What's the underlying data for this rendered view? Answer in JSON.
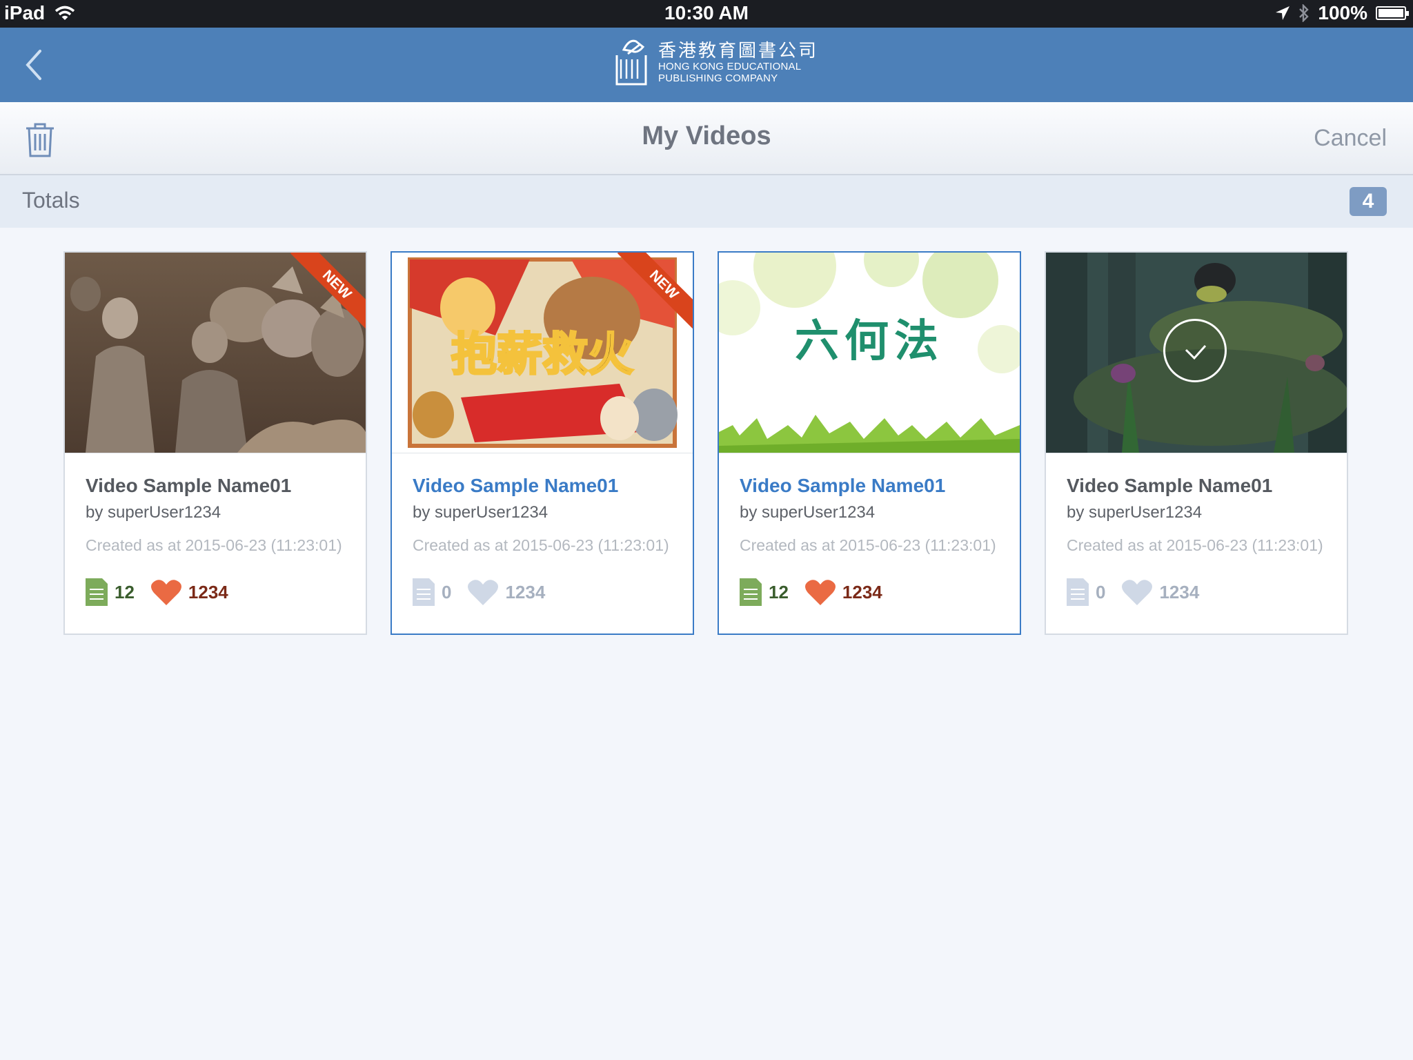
{
  "status_bar": {
    "device": "iPad",
    "time": "10:30 AM",
    "battery": "100%",
    "battery_level": 1.0
  },
  "header": {
    "brand_cn": "香港教育圖書公司",
    "brand_en_line1": "HONG KONG EDUCATIONAL",
    "brand_en_line2": "PUBLISHING COMPANY"
  },
  "toolbar": {
    "title": "My Videos",
    "cancel_label": "Cancel"
  },
  "totals": {
    "label": "Totals",
    "count": "4"
  },
  "videos": [
    {
      "name": "Video Sample Name01",
      "author": "by superUser1234",
      "created": "Created as at 2015-06-23 (11:23:01)",
      "comments": "12",
      "likes": "1234",
      "badge": "NEW"
    },
    {
      "name": "Video Sample Name01",
      "author": "by superUser1234",
      "created": "Created as at 2015-06-23 (11:23:01)",
      "comments": "0",
      "likes": "1234",
      "badge": "NEW",
      "thumb_text": "抱薪救火"
    },
    {
      "name": "Video Sample Name01",
      "author": "by superUser1234",
      "created": "Created as at 2015-06-23 (11:23:01)",
      "comments": "12",
      "likes": "1234",
      "thumb_text": "六何法"
    },
    {
      "name": "Video Sample Name01",
      "author": "by superUser1234",
      "created": "Created as at 2015-06-23 (11:23:01)",
      "comments": "0",
      "likes": "1234"
    }
  ],
  "colors": {
    "nav_blue": "#4d80b8",
    "selected_blue": "#3a7bc6",
    "badge_red": "#d9441c",
    "heart_active": "#ea6a43",
    "doc_active": "#7dab5b",
    "inactive": "#cfd8e6"
  },
  "icons": [
    "back-chevron-icon",
    "trash-icon",
    "comment-document-icon",
    "heart-icon",
    "checkmark-icon",
    "wifi-icon",
    "location-arrow-icon",
    "bluetooth-icon",
    "battery-icon"
  ]
}
